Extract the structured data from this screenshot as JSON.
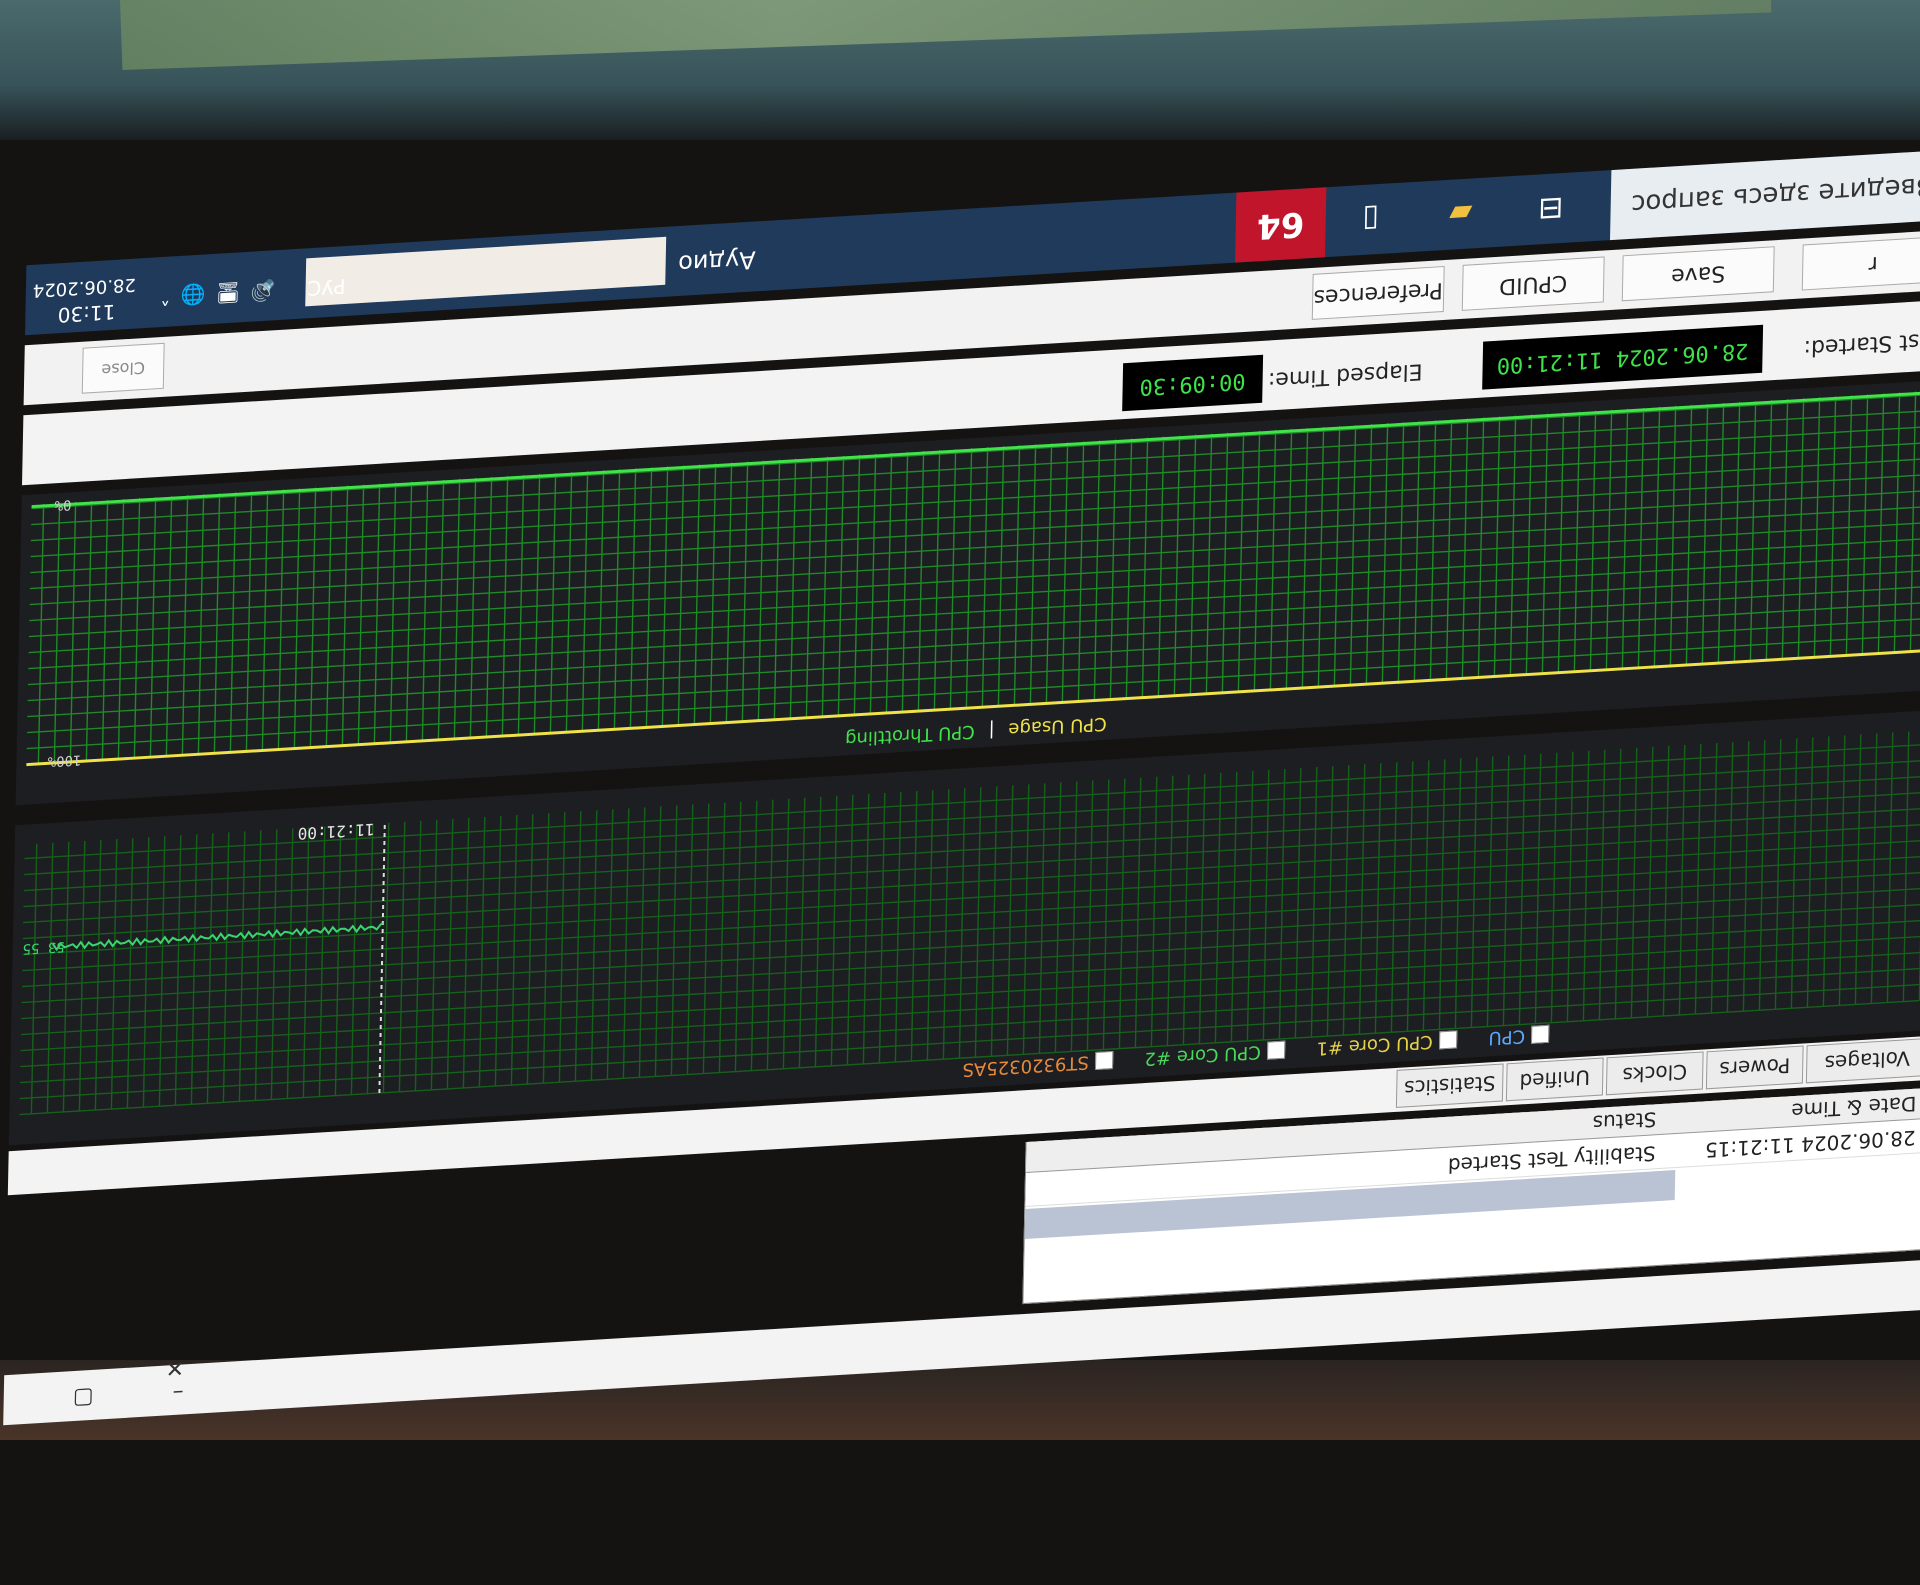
{
  "taskbar": {
    "search_placeholder": "Введите здесь запрос",
    "yandex_label": "Аудио",
    "tray_lang": "РУС",
    "tray_time": "11:30",
    "tray_date": "28.06.2024",
    "aida_label": "64"
  },
  "toolbar": {
    "save_label": "Save",
    "cpuid_label": "CPUID",
    "preferences_label": "Preferences",
    "close_label": "Close"
  },
  "status": {
    "test_started_label": "Test Started:",
    "test_started_value": "28.06.2024 11:21:00",
    "elapsed_label": "Elapsed Time:",
    "elapsed_value": "00:09:30"
  },
  "usage_graph": {
    "legend_usage": "CPU Usage",
    "legend_sep": "|",
    "legend_throttling": "CPU Throttling",
    "top_label": "100%",
    "bottom_label": "0%",
    "usage_color": "#f0e24a",
    "throttle_color": "#41e24a"
  },
  "temp_graph": {
    "legend_items": [
      "CPU",
      "CPU Core #1",
      "CPU Core #2",
      "ST9320325AS"
    ],
    "time_label": "11:21:00",
    "value_label": "53 55",
    "line_color": "#3cd46e"
  },
  "tabs": [
    "Voltages",
    "Powers",
    "Clocks",
    "Unified",
    "Statistics"
  ],
  "log": {
    "col_date": "Date & Time",
    "col_status": "Status",
    "row_date": "28.06.2024 11:21:15",
    "row_status": "Stability Test Started"
  },
  "colors": {
    "grid": "#1f8a26",
    "taskbar": "#1f3a5a",
    "screen_bg": "#1c1e22"
  }
}
